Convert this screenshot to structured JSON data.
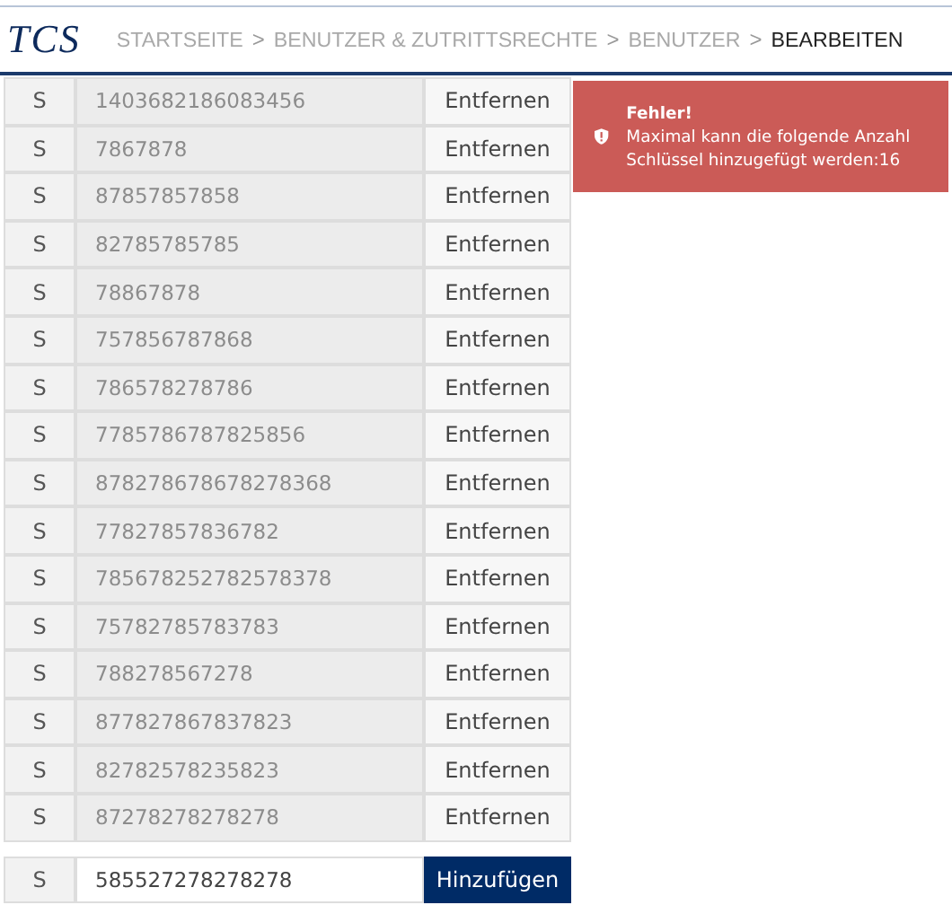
{
  "logo": "TCS",
  "breadcrumb": [
    {
      "label": "STARTSEITE",
      "selected": false
    },
    {
      "label": "BENUTZER & ZUTRITTSRECHTE",
      "selected": false
    },
    {
      "label": "BENUTZER",
      "selected": false
    },
    {
      "label": "BEARBEITEN",
      "selected": true
    }
  ],
  "separator": ">",
  "keys": [
    {
      "type": "S",
      "value": "1403682186083456",
      "action": "Entfernen"
    },
    {
      "type": "S",
      "value": "7867878",
      "action": "Entfernen"
    },
    {
      "type": "S",
      "value": "87857857858",
      "action": "Entfernen"
    },
    {
      "type": "S",
      "value": "82785785785",
      "action": "Entfernen"
    },
    {
      "type": "S",
      "value": "78867878",
      "action": "Entfernen"
    },
    {
      "type": "S",
      "value": "757856787868",
      "action": "Entfernen"
    },
    {
      "type": "S",
      "value": "786578278786",
      "action": "Entfernen"
    },
    {
      "type": "S",
      "value": "7785786787825856",
      "action": "Entfernen"
    },
    {
      "type": "S",
      "value": "878278678678278368",
      "action": "Entfernen"
    },
    {
      "type": "S",
      "value": "77827857836782",
      "action": "Entfernen"
    },
    {
      "type": "S",
      "value": "785678252782578378",
      "action": "Entfernen"
    },
    {
      "type": "S",
      "value": "75782785783783",
      "action": "Entfernen"
    },
    {
      "type": "S",
      "value": "788278567278",
      "action": "Entfernen"
    },
    {
      "type": "S",
      "value": "877827867837823",
      "action": "Entfernen"
    },
    {
      "type": "S",
      "value": "82782578235823",
      "action": "Entfernen"
    },
    {
      "type": "S",
      "value": "87278278278278",
      "action": "Entfernen"
    }
  ],
  "new_key": {
    "type": "S",
    "value": "585527278278278",
    "action": "Hinzufügen"
  },
  "error": {
    "title": "Fehler!",
    "message": "Maximal kann die folgende Anzahl Schlüssel hinzugefügt werden:16"
  }
}
